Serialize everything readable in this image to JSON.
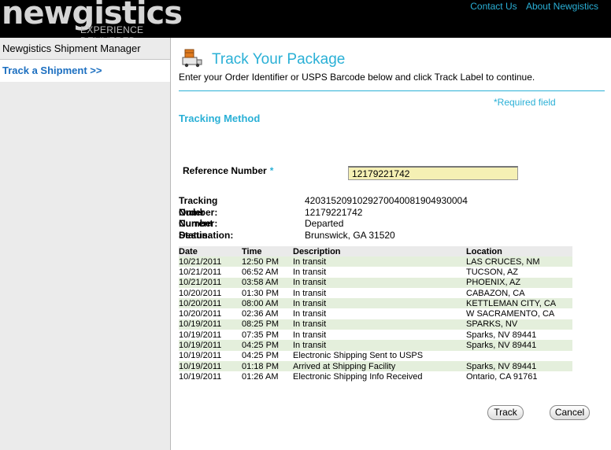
{
  "brand": {
    "name": "newgistics",
    "tagline": "EXPERIENCE DELIVERED"
  },
  "top_links": [
    "Contact Us",
    "About Newgistics"
  ],
  "sidebar": {
    "title": "Newgistics Shipment Manager",
    "link": "Track a Shipment >>"
  },
  "page": {
    "title": "Track Your Package",
    "instructions": "Enter your Order Identifier or USPS Barcode below and click Track Label to continue.",
    "required_note": "*Required field",
    "section": "Tracking Method"
  },
  "form": {
    "reference_label": "Reference Number",
    "required_mark": "*",
    "reference_value": "12179221742"
  },
  "summary": [
    {
      "label": "Tracking Number:",
      "value": "4203152091029270040081904930004"
    },
    {
      "label": "Order Number:",
      "value": "12179221742"
    },
    {
      "label": "Current Status:",
      "value": "Departed"
    },
    {
      "label": "Destination:",
      "value": "Brunswick, GA 31520"
    }
  ],
  "events_header": [
    "Date",
    "Time",
    "Description",
    "Location"
  ],
  "events": [
    [
      "10/21/2011",
      "12:50 PM",
      "In transit",
      "LAS CRUCES, NM"
    ],
    [
      "10/21/2011",
      "06:52 AM",
      "In transit",
      "TUCSON, AZ"
    ],
    [
      "10/21/2011",
      "03:58 AM",
      "In transit",
      "PHOENIX, AZ"
    ],
    [
      "10/20/2011",
      "01:30 PM",
      "In transit",
      "CABAZON, CA"
    ],
    [
      "10/20/2011",
      "08:00 AM",
      "In transit",
      "KETTLEMAN CITY, CA"
    ],
    [
      "10/20/2011",
      "02:36 AM",
      "In transit",
      "W SACRAMENTO, CA"
    ],
    [
      "10/19/2011",
      "08:25 PM",
      "In transit",
      "SPARKS, NV"
    ],
    [
      "10/19/2011",
      "07:35 PM",
      "In transit",
      "Sparks, NV 89441"
    ],
    [
      "10/19/2011",
      "04:25 PM",
      "In transit",
      "Sparks, NV 89441"
    ],
    [
      "10/19/2011",
      "04:25 PM",
      "Electronic Shipping Sent to USPS",
      ""
    ],
    [
      "10/19/2011",
      "01:18 PM",
      "Arrived at Shipping Facility",
      "Sparks, NV 89441"
    ],
    [
      "10/19/2011",
      "01:26 AM",
      "Electronic Shipping Info Received",
      "Ontario, CA 91761"
    ]
  ],
  "buttons": {
    "track": "Track",
    "cancel": "Cancel"
  },
  "colors": {
    "accent": "#2ab0d6",
    "link": "#1c6fc0",
    "row_alt": "#e4efdc",
    "input_bg": "#f5f0b4"
  }
}
